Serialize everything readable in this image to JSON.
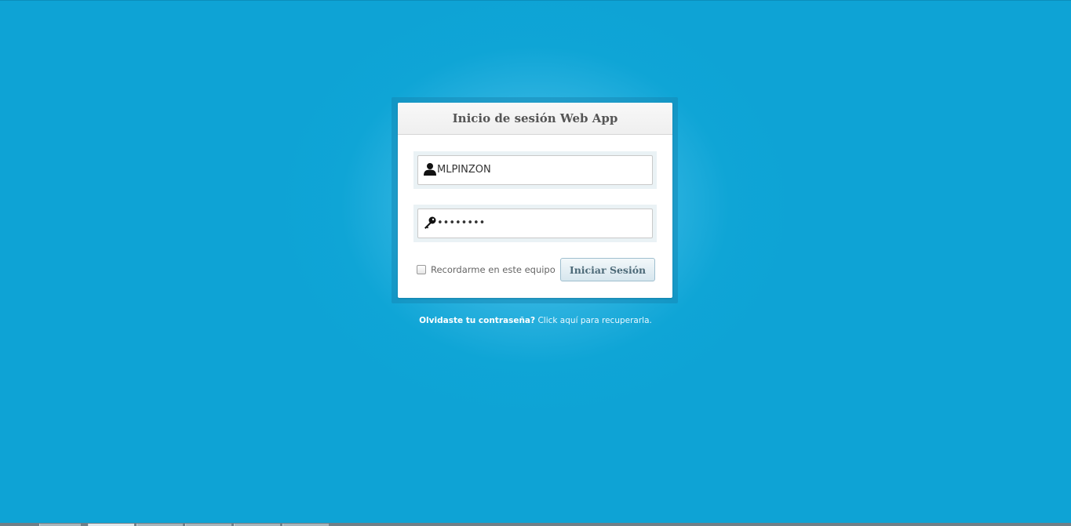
{
  "login": {
    "title": "Inicio de sesión Web App",
    "username": {
      "value": "MLPINZON",
      "icon": "user-icon"
    },
    "password": {
      "value": "••••••••",
      "icon": "key-icon"
    },
    "remember_label": "Recordarme en este equipo",
    "remember_checked": false,
    "submit_label": "Iniciar Sesión"
  },
  "footer": {
    "forgot_question": "Olvidaste tu contraseña?",
    "forgot_link": "Click aquí para recuperarla."
  },
  "colors": {
    "background": "#0ea3d5",
    "panel": "#ffffff",
    "title_text": "#555555",
    "button_text": "#4d6a78"
  }
}
